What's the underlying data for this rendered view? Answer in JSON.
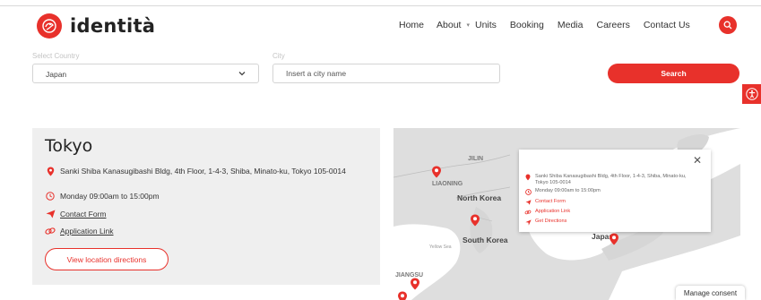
{
  "header": {
    "logo_text": "identità",
    "nav": {
      "home": "Home",
      "about": "About",
      "units": "Units",
      "booking": "Booking",
      "media": "Media",
      "careers": "Careers",
      "contact": "Contact Us"
    }
  },
  "filters": {
    "country_label": "Select Country",
    "country_value": "Japan",
    "city_label": "City",
    "city_placeholder": "Insert a city name",
    "search_label": "Search"
  },
  "location": {
    "city": "Tokyo",
    "address": "Sanki Shiba Kanasugibashi Bldg, 4th Floor, 1-4-3, Shiba, Minato-ku, Tokyo 105-0014",
    "hours": "Monday 09:00am to 15:00pm",
    "contact_form": "Contact Form",
    "application_link": "Application Link",
    "directions_button": "View location directions"
  },
  "map": {
    "labels": {
      "jilin": "JILIN",
      "liaoning": "LIAONING",
      "north_korea": "North Korea",
      "south_korea": "South Korea",
      "japan": "Japan",
      "jiangsu": "JIANGSU",
      "yellow_sea": "Yellow Sea"
    },
    "popup": {
      "address": "Sanki Shiba Kanasugibashi Bldg, 4th Floor, 1-4-3, Shiba, Minato-ku, Tokyo 105-0014",
      "hours": "Monday 09:00am to 15:00pm",
      "contact_form": "Contact Form",
      "application_link": "Application Link",
      "get_directions": "Get Directions"
    }
  },
  "consent": "Manage consent",
  "colors": {
    "brand_red": "#e8312b",
    "card_bg": "#efefef",
    "map_bg": "#e4e4e4"
  }
}
